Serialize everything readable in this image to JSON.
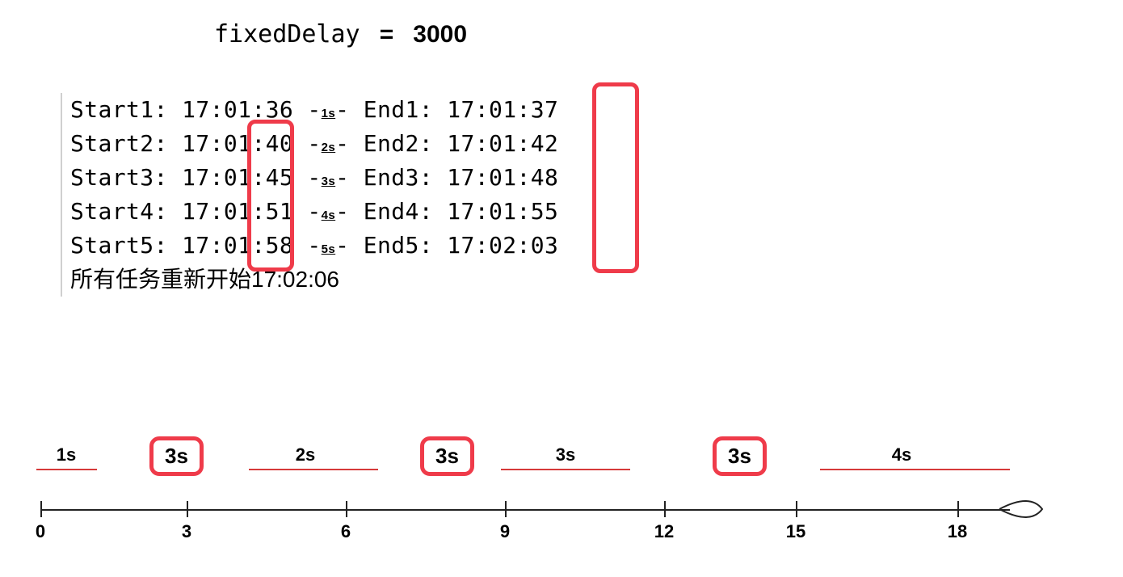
{
  "title": {
    "param": "fixedDelay",
    "eq": "=",
    "value": "3000"
  },
  "log": {
    "rows": [
      {
        "start_label": "Start1:",
        "start_time": "17:01:36",
        "duration": "1s",
        "end_label": "End1:",
        "end_time": "17:01:37"
      },
      {
        "start_label": "Start2:",
        "start_time": "17:01:40",
        "duration": "2s",
        "end_label": "End2:",
        "end_time": "17:01:42"
      },
      {
        "start_label": "Start3:",
        "start_time": "17:01:45",
        "duration": "3s",
        "end_label": "End3:",
        "end_time": "17:01:48"
      },
      {
        "start_label": "Start4:",
        "start_time": "17:01:51",
        "duration": "4s",
        "end_label": "End4:",
        "end_time": "17:01:55"
      },
      {
        "start_label": "Start5:",
        "start_time": "17:01:58",
        "duration": "5s",
        "end_label": "End5:",
        "end_time": "17:02:03"
      }
    ],
    "footer": "所有任务重新开始17:02:06"
  },
  "timeline": {
    "ticks": [
      {
        "pos": 0,
        "label": "0"
      },
      {
        "pos": 3,
        "label": "3"
      },
      {
        "pos": 6,
        "label": "6"
      },
      {
        "pos": 9,
        "label": "9"
      },
      {
        "pos": 12,
        "label": "12"
      },
      {
        "pos": 15,
        "label": "15"
      },
      {
        "pos": 18,
        "label": "18"
      }
    ],
    "segments": [
      {
        "label": "1s",
        "from": 0,
        "to": 1
      },
      {
        "label": "2s",
        "from": 4.5,
        "to": 7
      },
      {
        "label": "3s",
        "from": 9.5,
        "to": 12
      },
      {
        "label": "4s",
        "from": 15.3,
        "to": 18.5
      }
    ],
    "delays": [
      {
        "label": "3s",
        "at": 2.6
      },
      {
        "label": "3s",
        "at": 7.8
      },
      {
        "label": "3s",
        "at": 13.3
      }
    ]
  }
}
